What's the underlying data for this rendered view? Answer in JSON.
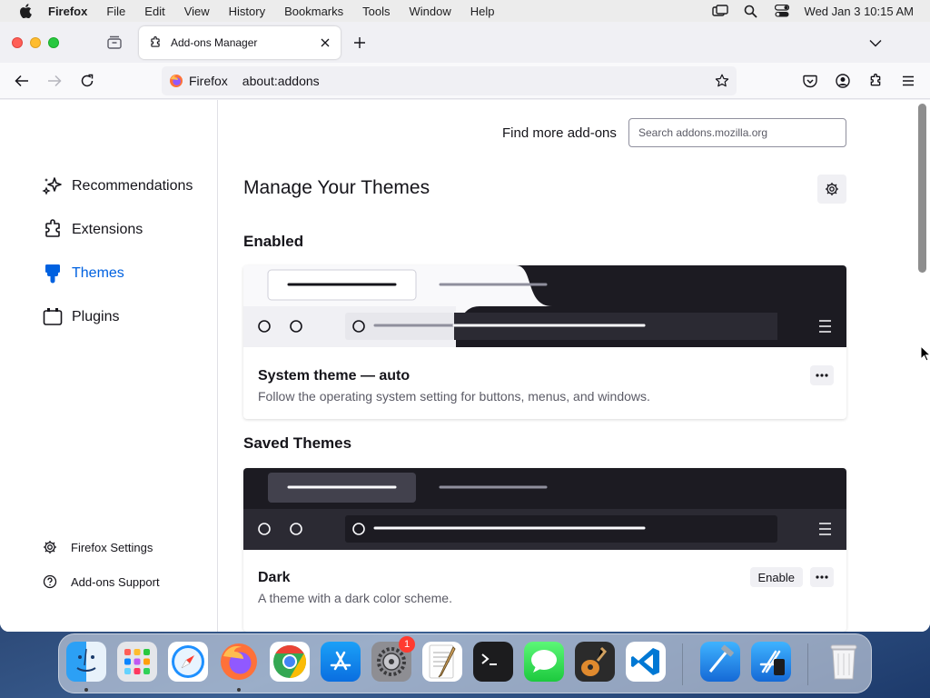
{
  "menubar": {
    "app_name": "Firefox",
    "items": [
      "File",
      "Edit",
      "View",
      "History",
      "Bookmarks",
      "Tools",
      "Window",
      "Help"
    ],
    "clock": "Wed Jan 3  10:15 AM"
  },
  "tab": {
    "title": "Add-ons Manager"
  },
  "urlbar": {
    "identity_label": "Firefox",
    "url": "about:addons"
  },
  "sidebar": {
    "categories": [
      {
        "label": "Recommendations",
        "icon": "sparkle-icon"
      },
      {
        "label": "Extensions",
        "icon": "puzzle-icon"
      },
      {
        "label": "Themes",
        "icon": "brush-icon",
        "selected": true
      },
      {
        "label": "Plugins",
        "icon": "plugin-icon"
      }
    ],
    "settings_label": "Firefox Settings",
    "support_label": "Add-ons Support"
  },
  "main": {
    "find_more_label": "Find more add-ons",
    "search_placeholder": "Search addons.mozilla.org",
    "page_title": "Manage Your Themes",
    "enabled_heading": "Enabled",
    "saved_heading": "Saved Themes",
    "enabled_theme": {
      "name": "System theme — auto",
      "description": "Follow the operating system setting for buttons, menus, and windows."
    },
    "saved_themes": [
      {
        "name": "Dark",
        "description": "A theme with a dark color scheme.",
        "enable_label": "Enable"
      }
    ]
  },
  "dock": {
    "apps": [
      "Finder",
      "Launchpad",
      "Safari",
      "Firefox",
      "Chrome",
      "App Store",
      "System Settings",
      "TextEdit",
      "Terminal",
      "Messages",
      "GarageBand",
      "VS Code",
      "Xcode",
      "Simulator",
      "Trash"
    ],
    "system_settings_badge": "1"
  },
  "colors": {
    "accent": "#0061e0",
    "dark_theme_bg": "#1c1b22",
    "light_toolbar": "#f9f9fb"
  }
}
